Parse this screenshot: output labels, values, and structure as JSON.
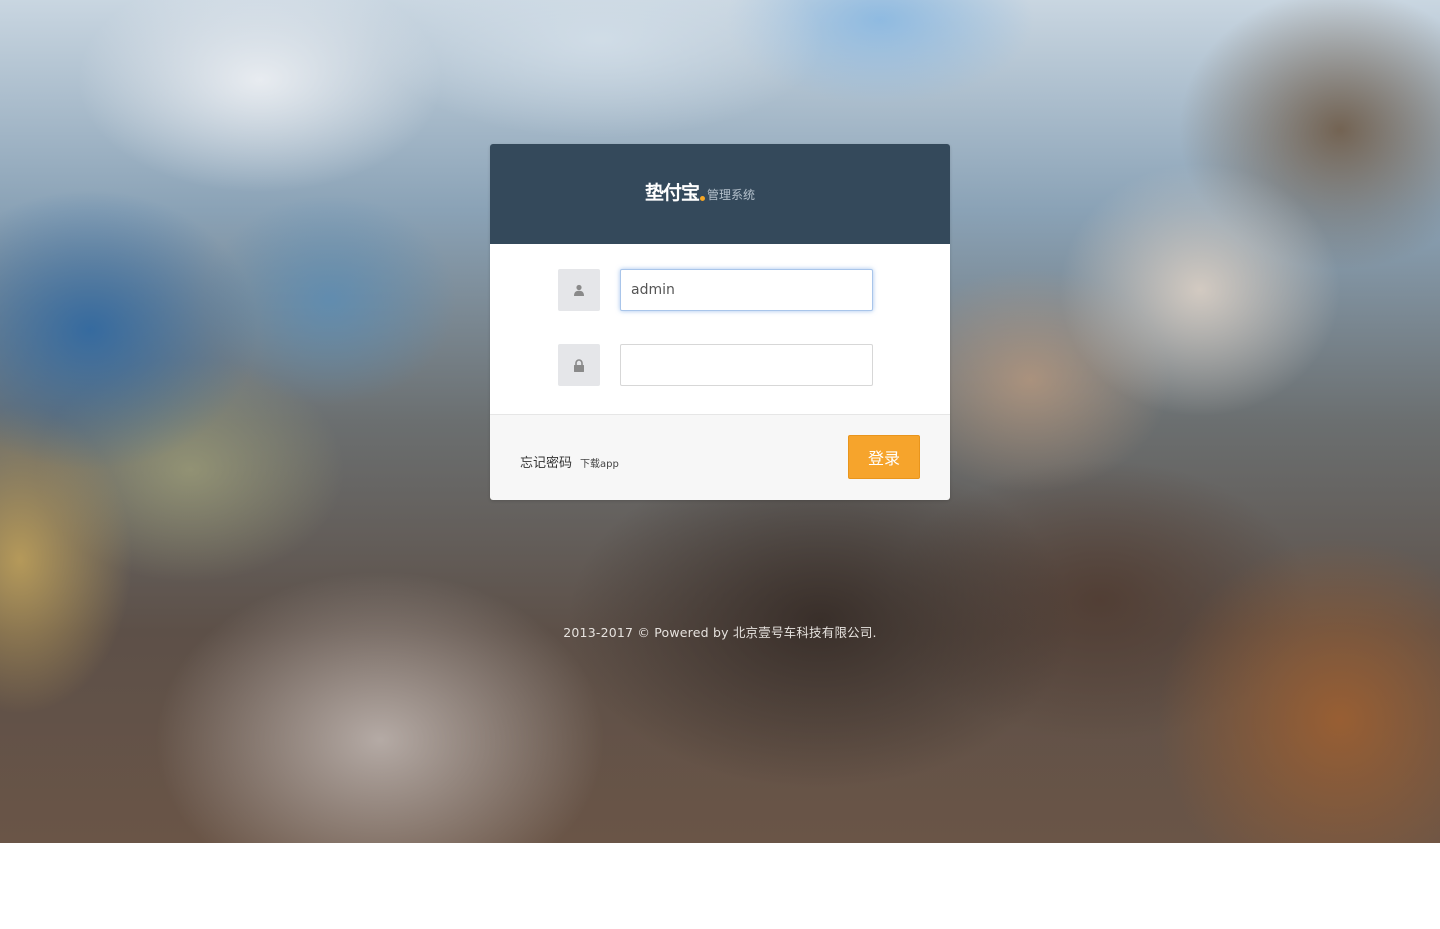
{
  "brand": {
    "logo_text": "垫付宝",
    "subtitle": "管理系统",
    "accent_color": "#f5a623",
    "header_color": "#34495b"
  },
  "login_form": {
    "username": {
      "icon": "user-icon",
      "value": "admin",
      "placeholder": ""
    },
    "password": {
      "icon": "lock-icon",
      "value": "",
      "placeholder": ""
    }
  },
  "footer_links": {
    "forgot_password": "忘记密码",
    "download_app": "下载app"
  },
  "login_button": {
    "label": "登录",
    "color": "#f6a42c"
  },
  "copyright": "2013-2017 © Powered by 北京壹号车科技有限公司."
}
